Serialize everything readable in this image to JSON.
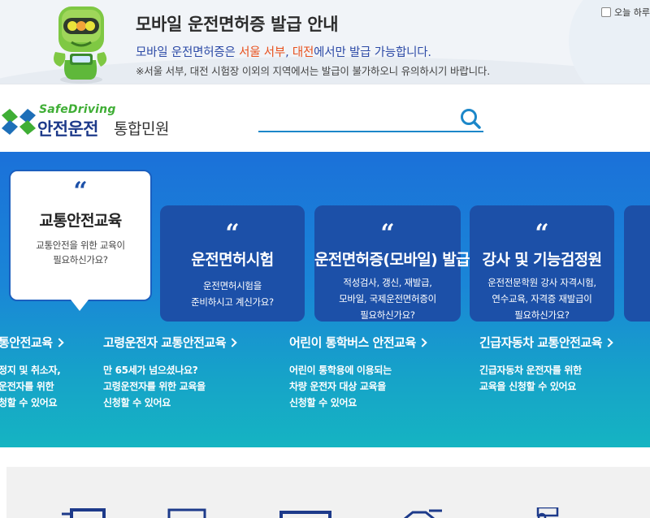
{
  "banner": {
    "title": "모바일 운전면허증 발급 안내",
    "line1_prefix": "모바일 운전면허증은 ",
    "line1_region1": "서울 서부",
    "line1_sep": ", ",
    "line1_region2": "대전",
    "line1_suffix": "에서만 발급 가능합니다.",
    "line2": "※서울 서부, 대전 시험장 이외의 지역에서는 발급이 불가하오니 유의하시기 바랍니다.",
    "today_close_label": "오늘 하루"
  },
  "header": {
    "logo_en": "SafeDriving",
    "logo_ko": "안전운전",
    "logo_sub": "통합민원",
    "search_value": ""
  },
  "cards": [
    {
      "quote": "“",
      "title": "교통안전교육",
      "desc_line1": "교통안전을 위한 교육이",
      "desc_line2": "필요하신가요?"
    },
    {
      "quote": "“",
      "title": "운전면허시험",
      "desc_line1": "운전면허시험을",
      "desc_line2": "준비하시고 계신가요?"
    },
    {
      "quote": "“",
      "title": "운전면허증(모바일) 발급",
      "desc_line1": "적성검사, 갱신, 재발급,",
      "desc_line2": "모바일, 국제운전면허증이",
      "desc_line3": "필요하신가요?"
    },
    {
      "quote": "“",
      "title": "강사 및 기능검정원",
      "desc_line1": "운전전문학원 강사 자격시험,",
      "desc_line2": "연수교육, 자격증 재발급이",
      "desc_line3": "필요하신가요?"
    }
  ],
  "courses": [
    {
      "title": "통안전교육",
      "desc1": "정지 및 취소자,",
      "desc2": "운전자를 위한",
      "desc3": "청할 수 있어요"
    },
    {
      "title": "고령운전자 교통안전교육",
      "desc1": "만 65세가 넘으셨나요?",
      "desc2": "고령운전자를 위한 교육을",
      "desc3": "신청할 수 있어요"
    },
    {
      "title": "어린이 통학버스 안전교육",
      "desc1": "어린이 통학용에 이용되는",
      "desc2": "차량 운전자 대상 교육을",
      "desc3": "신청할 수 있어요"
    },
    {
      "title": "긴급자동차 교통안전교육",
      "desc1": "긴급자동차 운전자를 위한",
      "desc2": "교육을 신청할 수 있어요"
    }
  ],
  "quick_icons": [
    "monitor-icon",
    "document-icon",
    "keyboard-icon",
    "car-license-icon",
    "person-board-icon"
  ],
  "colors": {
    "brand_navy": "#1d3a8a",
    "brand_green": "#3fae35",
    "highlight_orange": "#e8511d",
    "hero_top": "#1b71d9",
    "hero_bottom": "#15b4c2",
    "card_dark": "#1c50a8"
  }
}
